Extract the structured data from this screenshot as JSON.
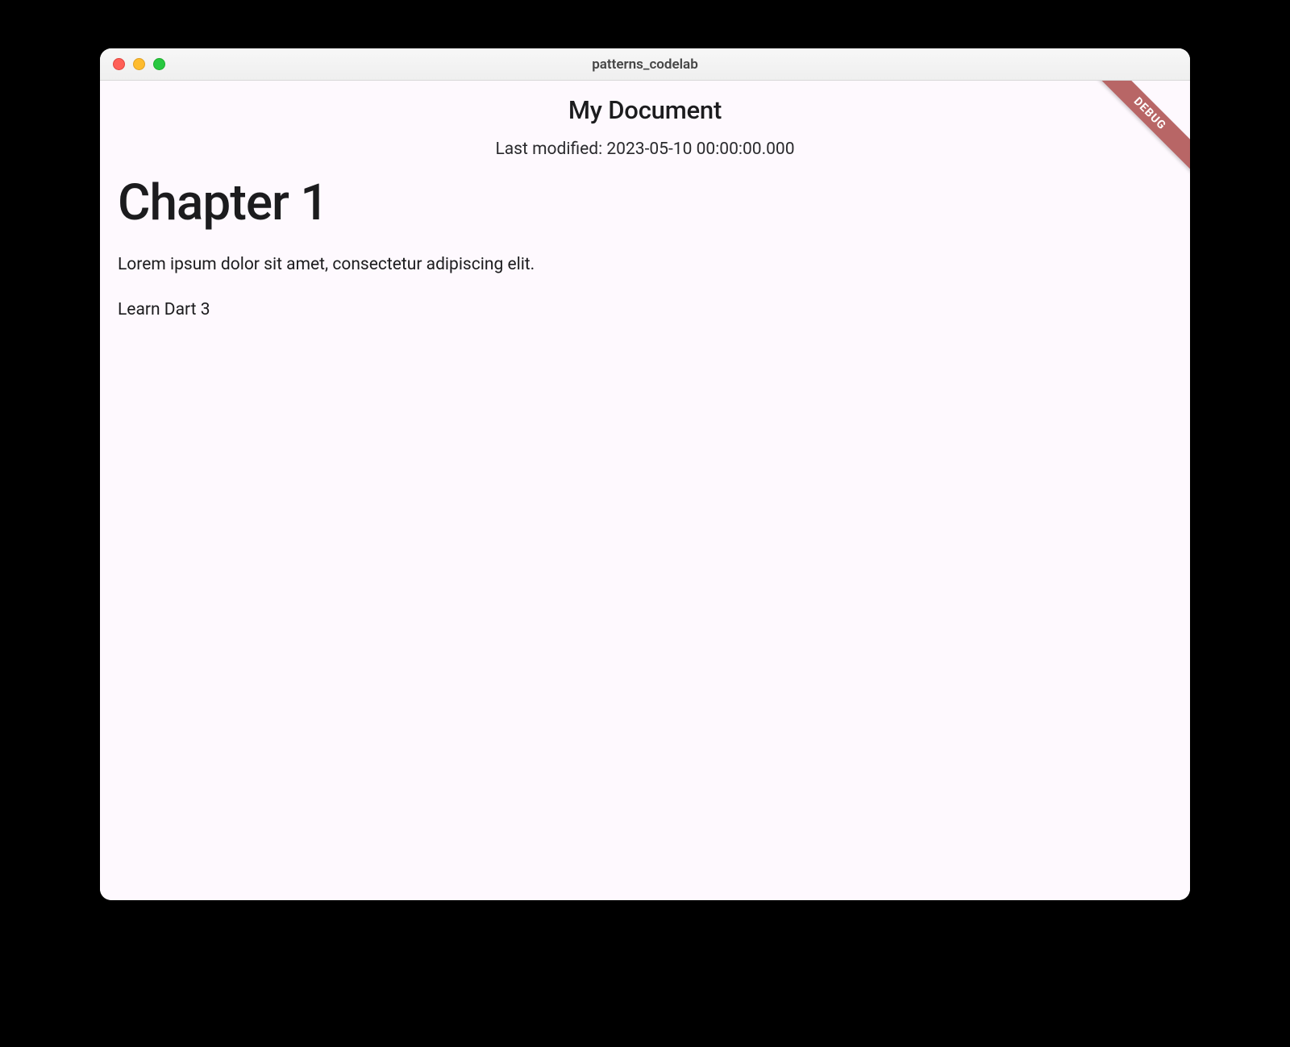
{
  "window": {
    "title": "patterns_codelab",
    "debug_banner": "DEBUG"
  },
  "header": {
    "title": "My Document",
    "last_modified": "Last modified: 2023-05-10 00:00:00.000"
  },
  "content": {
    "chapter_title": "Chapter 1",
    "body": "Lorem ipsum dolor sit amet, consectetur adipiscing elit.",
    "list_item": "Learn Dart 3"
  }
}
